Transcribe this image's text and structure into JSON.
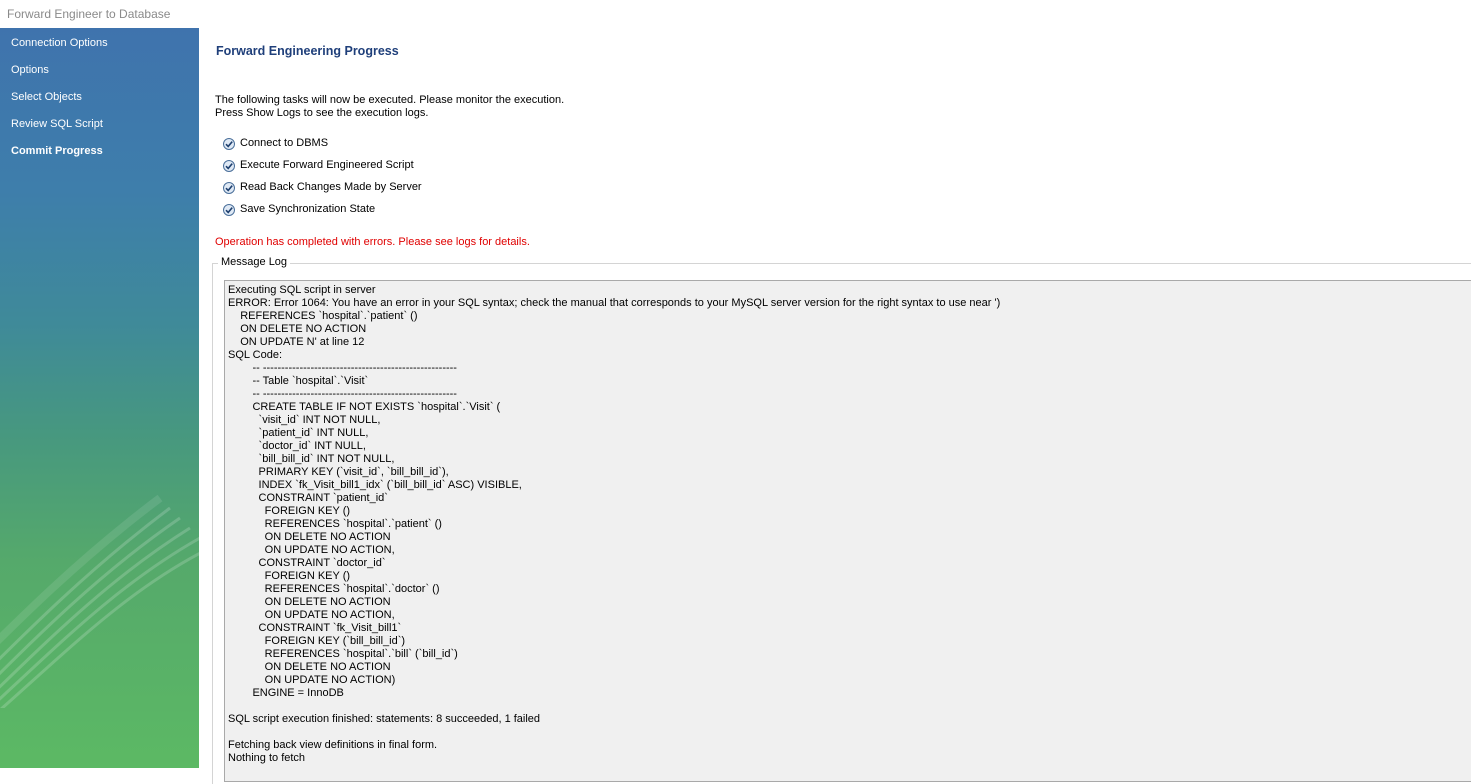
{
  "window": {
    "title": "Forward Engineer to Database"
  },
  "sidebar": {
    "items": [
      {
        "label": "Connection Options",
        "active": false
      },
      {
        "label": "Options",
        "active": false
      },
      {
        "label": "Select Objects",
        "active": false
      },
      {
        "label": "Review SQL Script",
        "active": false
      },
      {
        "label": "Commit Progress",
        "active": true
      }
    ]
  },
  "main": {
    "heading": "Forward Engineering Progress",
    "intro_line1": "The following tasks will now be executed. Please monitor the execution.",
    "intro_line2": "Press Show Logs to see the execution logs.",
    "tasks": [
      {
        "label": "Connect to DBMS",
        "status": "checked-icon"
      },
      {
        "label": "Execute Forward Engineered Script",
        "status": "checked-icon"
      },
      {
        "label": "Read Back Changes Made by Server",
        "status": "checked-icon"
      },
      {
        "label": "Save Synchronization State",
        "status": "checked-icon"
      }
    ],
    "error_message": "Operation has completed with errors. Please see logs for details.",
    "error_color": "#e00000",
    "message_log": {
      "label": "Message Log",
      "text": "Executing SQL script in server\nERROR: Error 1064: You have an error in your SQL syntax; check the manual that corresponds to your MySQL server version for the right syntax to use near ')\n    REFERENCES `hospital`.`patient` ()\n    ON DELETE NO ACTION\n    ON UPDATE N' at line 12\nSQL Code:\n        -- -----------------------------------------------------\n        -- Table `hospital`.`Visit`\n        -- -----------------------------------------------------\n        CREATE TABLE IF NOT EXISTS `hospital`.`Visit` (\n          `visit_id` INT NOT NULL,\n          `patient_id` INT NULL,\n          `doctor_id` INT NULL,\n          `bill_bill_id` INT NOT NULL,\n          PRIMARY KEY (`visit_id`, `bill_bill_id`),\n          INDEX `fk_Visit_bill1_idx` (`bill_bill_id` ASC) VISIBLE,\n          CONSTRAINT `patient_id`\n            FOREIGN KEY ()\n            REFERENCES `hospital`.`patient` ()\n            ON DELETE NO ACTION\n            ON UPDATE NO ACTION,\n          CONSTRAINT `doctor_id`\n            FOREIGN KEY ()\n            REFERENCES `hospital`.`doctor` ()\n            ON DELETE NO ACTION\n            ON UPDATE NO ACTION,\n          CONSTRAINT `fk_Visit_bill1`\n            FOREIGN KEY (`bill_bill_id`)\n            REFERENCES `hospital`.`bill` (`bill_id`)\n            ON DELETE NO ACTION\n            ON UPDATE NO ACTION)\n        ENGINE = InnoDB\n\nSQL script execution finished: statements: 8 succeeded, 1 failed\n\nFetching back view definitions in final form.\nNothing to fetch"
    }
  }
}
